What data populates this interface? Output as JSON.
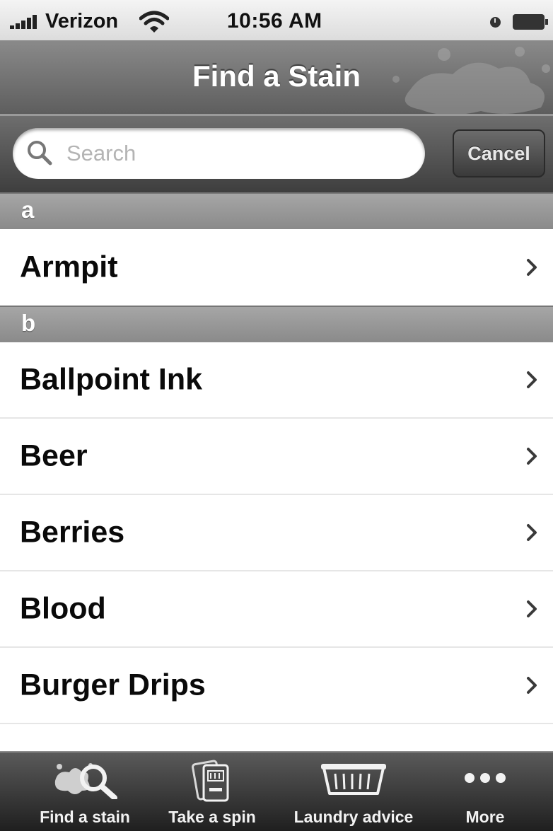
{
  "status_bar": {
    "carrier": "Verizon",
    "time": "10:56 AM"
  },
  "nav": {
    "title": "Find a Stain"
  },
  "search": {
    "placeholder": "Search",
    "value": "",
    "cancel_label": "Cancel"
  },
  "sections": [
    {
      "header": "a",
      "items": [
        "Armpit"
      ]
    },
    {
      "header": "b",
      "items": [
        "Ballpoint Ink",
        "Beer",
        "Berries",
        "Blood",
        "Burger Drips"
      ]
    }
  ],
  "tabs": [
    {
      "label": "Find a stain",
      "icon": "stain-search-icon"
    },
    {
      "label": "Take a spin",
      "icon": "phone-spin-icon"
    },
    {
      "label": "Laundry advice",
      "icon": "laundry-basket-icon"
    },
    {
      "label": "More",
      "icon": "more-dots-icon"
    }
  ]
}
